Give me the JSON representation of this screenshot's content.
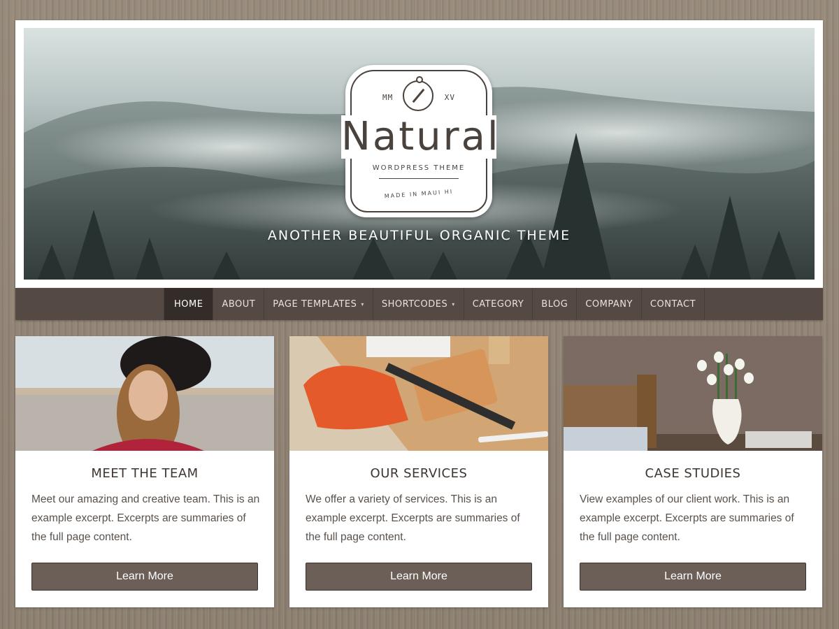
{
  "header": {
    "logo": {
      "top_left": "MM",
      "top_right": "XV",
      "title": "Natural",
      "subtitle": "WORDPRESS THEME",
      "made_in": "MADE IN MAUI HI"
    },
    "tagline": "ANOTHER BEAUTIFUL ORGANIC THEME"
  },
  "nav": {
    "items": [
      {
        "label": "HOME",
        "active": true,
        "dropdown": false
      },
      {
        "label": "ABOUT",
        "active": false,
        "dropdown": false
      },
      {
        "label": "PAGE TEMPLATES",
        "active": false,
        "dropdown": true
      },
      {
        "label": "SHORTCODES",
        "active": false,
        "dropdown": true
      },
      {
        "label": "CATEGORY",
        "active": false,
        "dropdown": false
      },
      {
        "label": "BLOG",
        "active": false,
        "dropdown": false
      },
      {
        "label": "COMPANY",
        "active": false,
        "dropdown": false
      },
      {
        "label": "CONTACT",
        "active": false,
        "dropdown": false
      }
    ],
    "caret": "▾"
  },
  "cards": [
    {
      "title": "MEET THE TEAM",
      "excerpt": "Meet our amazing and creative team. This is an example excerpt. Excerpts are summaries of the full page content.",
      "button": "Learn More"
    },
    {
      "title": "OUR SERVICES",
      "excerpt": "We offer a variety of services. This is an example excerpt. Excerpts are summaries of the full page content.",
      "button": "Learn More"
    },
    {
      "title": "CASE STUDIES",
      "excerpt": "View examples of our client work. This is an example excerpt. Excerpts are summaries of the full page content.",
      "button": "Learn More"
    }
  ],
  "colors": {
    "nav_bg": "#544a43",
    "nav_active": "#332c28",
    "button_bg": "#6b5f57",
    "title_text": "#3e3530",
    "body_text": "#5a514b",
    "wood_bg": "#8f8273"
  }
}
